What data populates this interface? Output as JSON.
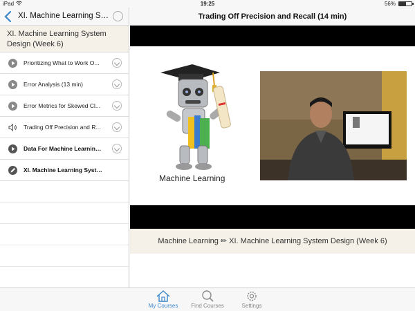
{
  "status_bar": {
    "device": "iPad",
    "time": "19:25",
    "battery": "56%",
    "battery_level": 0.56
  },
  "sidebar": {
    "nav_title": "XI. Machine Learning Syst...",
    "section_header": "XI. Machine Learning System Design (Week 6)",
    "lessons": [
      {
        "label": "Prioritizing What to Work O...",
        "icon": "play-circle-icon",
        "bold": false
      },
      {
        "label": "Error Analysis (13 min)",
        "icon": "play-circle-icon",
        "bold": false
      },
      {
        "label": "Error Metrics for Skewed Cl...",
        "icon": "play-circle-icon",
        "bold": false
      },
      {
        "label": "Trading Off Precision and R...",
        "icon": "speaker-icon",
        "bold": false
      },
      {
        "label": "Data For Machine Learning...",
        "icon": "play-circle-icon",
        "bold": true
      },
      {
        "label": "XI. Machine Learning Syste...",
        "icon": "pencil-circle-icon",
        "bold": true
      }
    ]
  },
  "main": {
    "title": "Trading Off Precision and Recall (14 min)",
    "slide_text": "Machine Learning",
    "caption": "Machine Learning ✏ XI. Machine Learning System Design (Week 6)"
  },
  "tabbar": {
    "tabs": [
      {
        "label": "My Courses",
        "icon": "house-icon",
        "active": true
      },
      {
        "label": "Find Courses",
        "icon": "magnifier-icon",
        "active": false
      },
      {
        "label": "Settings",
        "icon": "gear-icon",
        "active": false
      }
    ]
  },
  "colors": {
    "accent": "#3a87c9",
    "header_bg": "#f5f1e8"
  }
}
